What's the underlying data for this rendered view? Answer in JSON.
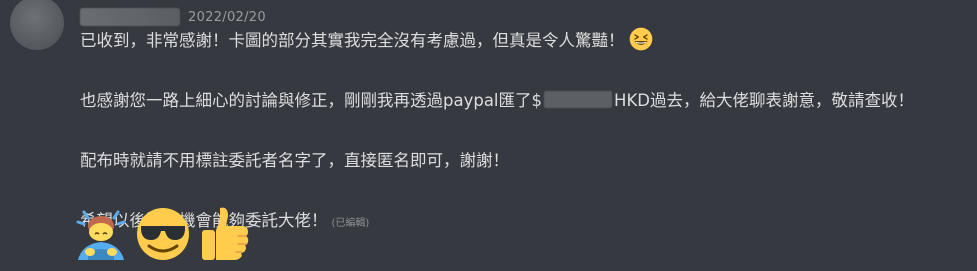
{
  "message": {
    "timestamp": "2022/02/20",
    "lines": {
      "l1": "已收到，非常感謝！卡圖的部分其實我完全沒有考慮過，但真是令人驚豔！",
      "l2_before": "也感謝您一路上細心的討論與修正，剛剛我再透過paypal匯了$",
      "l2_after": "HKD過去，給大佬聊表謝意，敬請查收！",
      "l3": "配布時就請不用標註委託者名字了，直接匿名即可，謝謝！",
      "l4": "希望以後還有機會能夠委託大佬！"
    },
    "edited_label": "(已編輯)",
    "inline_emoji": "grinning-squinting-face",
    "emojis": [
      "person-bowing",
      "smiling-face-with-sunglasses",
      "thumbs-up"
    ]
  }
}
